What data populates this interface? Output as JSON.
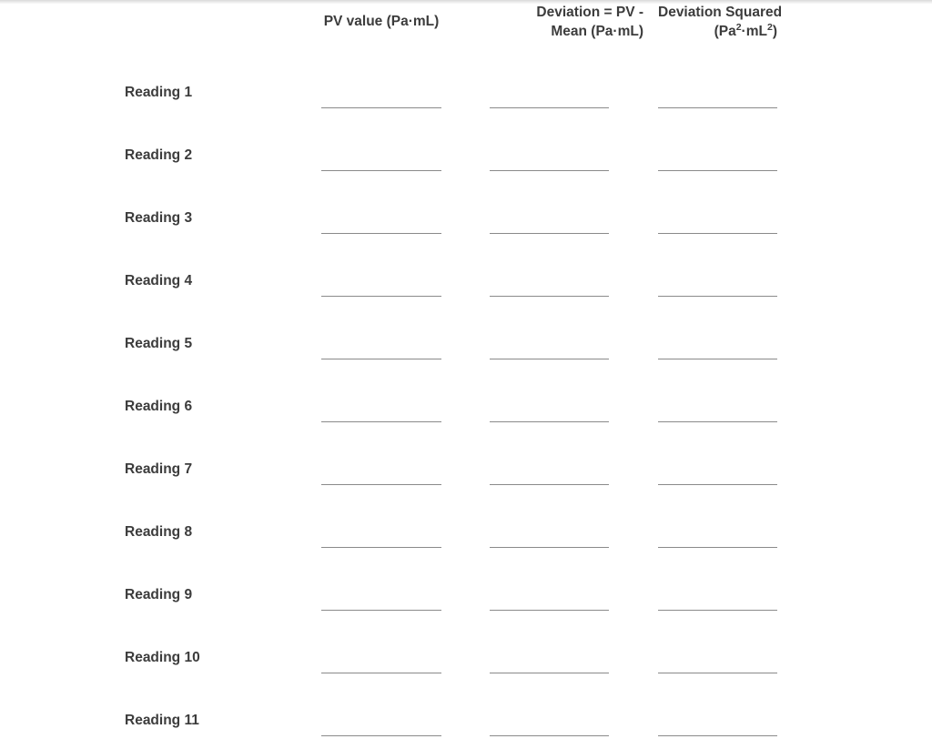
{
  "document": {
    "type": "data-entry-worksheet",
    "background_color": "#ffffff",
    "text_color": "#3c3c3c",
    "rule_color": "#8a8a8a"
  },
  "table": {
    "headers": {
      "label_column": "",
      "pv_value": "PV value (Pa·mL)",
      "deviation_line1": "Deviation = PV -",
      "deviation_line2": "Mean (Pa·mL)",
      "deviation_squared_line1": "Deviation Squared",
      "deviation_squared_line2_prefix": "(Pa",
      "deviation_squared_line2_sup1": "2",
      "deviation_squared_line2_mid": "·mL",
      "deviation_squared_line2_sup2": "2",
      "deviation_squared_line2_suffix": ")"
    },
    "rows": [
      {
        "label": "Reading 1",
        "pv_value": "",
        "deviation": "",
        "deviation_squared": ""
      },
      {
        "label": "Reading 2",
        "pv_value": "",
        "deviation": "",
        "deviation_squared": ""
      },
      {
        "label": "Reading 3",
        "pv_value": "",
        "deviation": "",
        "deviation_squared": ""
      },
      {
        "label": "Reading 4",
        "pv_value": "",
        "deviation": "",
        "deviation_squared": ""
      },
      {
        "label": "Reading 5",
        "pv_value": "",
        "deviation": "",
        "deviation_squared": ""
      },
      {
        "label": "Reading 6",
        "pv_value": "",
        "deviation": "",
        "deviation_squared": ""
      },
      {
        "label": "Reading 7",
        "pv_value": "",
        "deviation": "",
        "deviation_squared": ""
      },
      {
        "label": "Reading 8",
        "pv_value": "",
        "deviation": "",
        "deviation_squared": ""
      },
      {
        "label": "Reading 9",
        "pv_value": "",
        "deviation": "",
        "deviation_squared": ""
      },
      {
        "label": "Reading 10",
        "pv_value": "",
        "deviation": "",
        "deviation_squared": ""
      },
      {
        "label": "Reading 11",
        "pv_value": "",
        "deviation": "",
        "deviation_squared": ""
      }
    ]
  }
}
